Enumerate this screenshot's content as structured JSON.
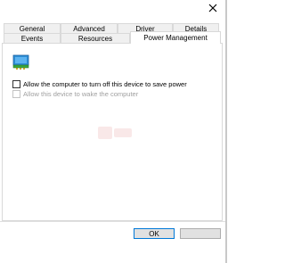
{
  "window": {
    "close_glyph": "✕"
  },
  "tabs": {
    "row_back": [
      {
        "label": "General"
      },
      {
        "label": "Advanced"
      },
      {
        "label": "Driver"
      },
      {
        "label": "Details"
      }
    ],
    "row_front": [
      {
        "label": "Events"
      },
      {
        "label": "Resources"
      },
      {
        "label": "Power Management",
        "active": true
      }
    ]
  },
  "power_management": {
    "device_icon": "network-adapter-icon",
    "options": [
      {
        "label": "Allow the computer to turn off this device to save power",
        "checked": false,
        "enabled": true
      },
      {
        "label": "Allow this device to wake the computer",
        "checked": false,
        "enabled": false
      }
    ]
  },
  "footer": {
    "ok_label": "OK",
    "cancel_label": ""
  },
  "colors": {
    "tab_bg": "#f0f0f0",
    "active_tab_bg": "#ffffff",
    "border": "#d9d9d9",
    "disabled_text": "#a0a0a0",
    "button_bg": "#e1e1e1",
    "default_button_border": "#0078d7",
    "icon_blue": "#2f8fd6",
    "icon_green": "#3aa63a"
  }
}
